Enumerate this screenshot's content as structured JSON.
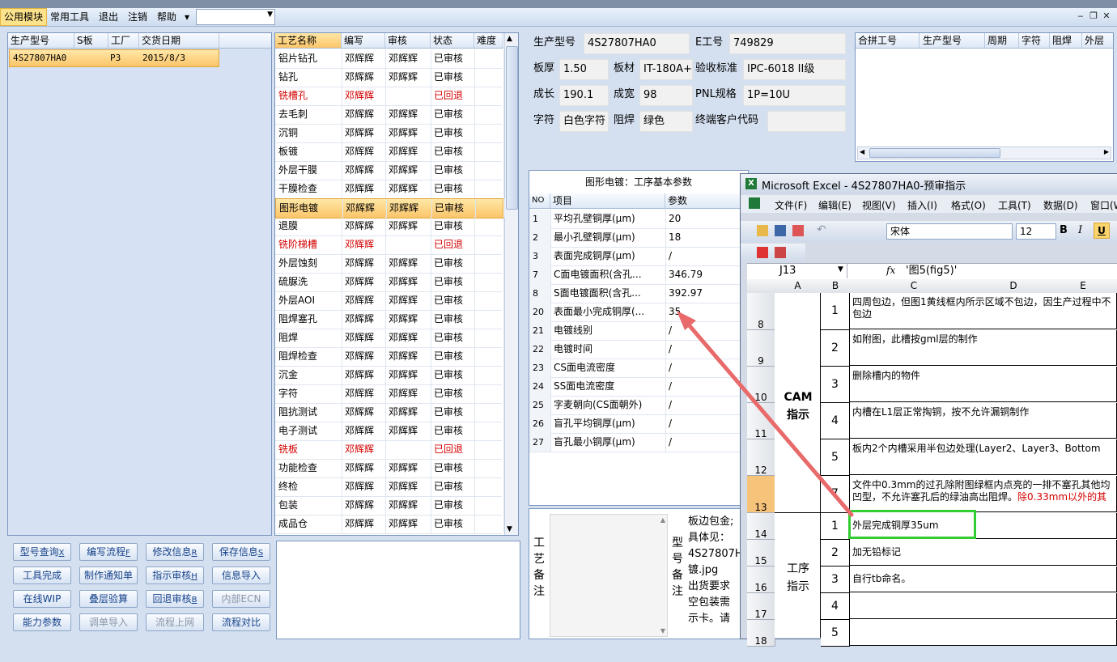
{
  "menu": {
    "items": [
      "公用模块",
      "常用工具",
      "退出",
      "注销",
      "帮助"
    ],
    "arrow": "▾"
  },
  "left_grid": {
    "headers": [
      "生产型号",
      "S板",
      "工厂",
      "交货日期"
    ],
    "rows": [
      {
        "model": "4S27807HA0",
        "s": "",
        "factory": "P3",
        "date": "2015/8/3"
      }
    ]
  },
  "process_grid": {
    "headers": [
      "工艺名称",
      "编写",
      "审核",
      "状态",
      "难度"
    ],
    "rows": [
      {
        "name": "铝片钻孔",
        "author": "邓辉辉",
        "reviewer": "邓辉辉",
        "status": "已审核",
        "red": false
      },
      {
        "name": "钻孔",
        "author": "邓辉辉",
        "reviewer": "邓辉辉",
        "status": "已审核",
        "red": false
      },
      {
        "name": "铣槽孔",
        "author": "邓辉辉",
        "reviewer": "",
        "status": "已回退",
        "red": true
      },
      {
        "name": "去毛刺",
        "author": "邓辉辉",
        "reviewer": "邓辉辉",
        "status": "已审核",
        "red": false
      },
      {
        "name": "沉铜",
        "author": "邓辉辉",
        "reviewer": "邓辉辉",
        "status": "已审核",
        "red": false
      },
      {
        "name": "板镀",
        "author": "邓辉辉",
        "reviewer": "邓辉辉",
        "status": "已审核",
        "red": false
      },
      {
        "name": "外层干膜",
        "author": "邓辉辉",
        "reviewer": "邓辉辉",
        "status": "已审核",
        "red": false
      },
      {
        "name": "干膜检查",
        "author": "邓辉辉",
        "reviewer": "邓辉辉",
        "status": "已审核",
        "red": false
      },
      {
        "name": "图形电镀",
        "author": "邓辉辉",
        "reviewer": "邓辉辉",
        "status": "已审核",
        "red": false,
        "selected": true
      },
      {
        "name": "退膜",
        "author": "邓辉辉",
        "reviewer": "邓辉辉",
        "status": "已审核",
        "red": false
      },
      {
        "name": "铣阶梯槽",
        "author": "邓辉辉",
        "reviewer": "",
        "status": "已回退",
        "red": true
      },
      {
        "name": "外层蚀刻",
        "author": "邓辉辉",
        "reviewer": "邓辉辉",
        "status": "已审核",
        "red": false
      },
      {
        "name": "硫脲洗",
        "author": "邓辉辉",
        "reviewer": "邓辉辉",
        "status": "已审核",
        "red": false
      },
      {
        "name": "外层AOI",
        "author": "邓辉辉",
        "reviewer": "邓辉辉",
        "status": "已审核",
        "red": false
      },
      {
        "name": "阻焊塞孔",
        "author": "邓辉辉",
        "reviewer": "邓辉辉",
        "status": "已审核",
        "red": false
      },
      {
        "name": "阻焊",
        "author": "邓辉辉",
        "reviewer": "邓辉辉",
        "status": "已审核",
        "red": false
      },
      {
        "name": "阻焊检查",
        "author": "邓辉辉",
        "reviewer": "邓辉辉",
        "status": "已审核",
        "red": false
      },
      {
        "name": "沉金",
        "author": "邓辉辉",
        "reviewer": "邓辉辉",
        "status": "已审核",
        "red": false
      },
      {
        "name": "字符",
        "author": "邓辉辉",
        "reviewer": "邓辉辉",
        "status": "已审核",
        "red": false
      },
      {
        "name": "阻抗测试",
        "author": "邓辉辉",
        "reviewer": "邓辉辉",
        "status": "已审核",
        "red": false
      },
      {
        "name": "电子测试",
        "author": "邓辉辉",
        "reviewer": "邓辉辉",
        "status": "已审核",
        "red": false
      },
      {
        "name": "铣板",
        "author": "邓辉辉",
        "reviewer": "",
        "status": "已回退",
        "red": true
      },
      {
        "name": "功能检查",
        "author": "邓辉辉",
        "reviewer": "邓辉辉",
        "status": "已审核",
        "red": false
      },
      {
        "name": "终检",
        "author": "邓辉辉",
        "reviewer": "邓辉辉",
        "status": "已审核",
        "red": false
      },
      {
        "name": "包装",
        "author": "邓辉辉",
        "reviewer": "邓辉辉",
        "status": "已审核",
        "red": false
      },
      {
        "name": "成品仓",
        "author": "邓辉辉",
        "reviewer": "邓辉辉",
        "status": "已审核",
        "red": false
      }
    ]
  },
  "buttons": [
    {
      "label": "型号查询",
      "key": "X",
      "disabled": false
    },
    {
      "label": "编写流程",
      "key": "F",
      "disabled": false
    },
    {
      "label": "修改信息",
      "key": "R",
      "disabled": false
    },
    {
      "label": "保存信息",
      "key": "S",
      "disabled": false
    },
    {
      "label": "工具完成",
      "key": "",
      "disabled": false
    },
    {
      "label": "制作通知单",
      "key": "",
      "disabled": false
    },
    {
      "label": "指示审核",
      "key": "H",
      "disabled": false
    },
    {
      "label": "信息导入",
      "key": "",
      "disabled": false
    },
    {
      "label": "在线WIP",
      "key": "",
      "disabled": false
    },
    {
      "label": "叠层验算",
      "key": "",
      "disabled": false
    },
    {
      "label": "回退审核",
      "key": "B",
      "disabled": false
    },
    {
      "label": "内部ECN",
      "key": "",
      "disabled": true
    },
    {
      "label": "能力参数",
      "key": "",
      "disabled": false
    },
    {
      "label": "调单导入",
      "key": "",
      "disabled": true
    },
    {
      "label": "流程上网",
      "key": "",
      "disabled": true
    },
    {
      "label": "流程对比",
      "key": "",
      "disabled": false
    }
  ],
  "info": {
    "model_label": "生产型号",
    "model_value": "4S27807HA0",
    "e_label": "E工号",
    "e_value": "749829",
    "thickness_label": "板厚",
    "thickness_value": "1.50",
    "material_label": "板材",
    "material_value": "IT-180A+",
    "standard_label": "验收标准",
    "standard_value": "IPC-6018 II级",
    "length_label": "成长",
    "length_value": "190.1",
    "width_label": "成宽",
    "width_value": "98",
    "pnl_label": "PNL规格",
    "pnl_value": "1P=10U",
    "char_label": "字符",
    "char_value": "白色字符",
    "mask_label": "阻焊",
    "mask_value": "绿色",
    "customer_label": "终端客户代码",
    "customer_value": ""
  },
  "merge_grid": {
    "headers": [
      "合拼工号",
      "生产型号",
      "周期",
      "字符",
      "阻焊",
      "外层"
    ]
  },
  "param_panel": {
    "title": "图形电镀：工序基本参数",
    "headers": [
      "NO",
      "项目",
      "参数"
    ],
    "rows": [
      {
        "no": "1",
        "item": "平均孔壁铜厚(μm)",
        "value": "20"
      },
      {
        "no": "2",
        "item": "最小孔壁铜厚(μm)",
        "value": "18"
      },
      {
        "no": "3",
        "item": "表面完成铜厚(μm)",
        "value": "/"
      },
      {
        "no": "7",
        "item": "C面电镀面积(含孔...",
        "value": "346.79"
      },
      {
        "no": "8",
        "item": "S面电镀面积(含孔...",
        "value": "392.97"
      },
      {
        "no": "20",
        "item": "表面最小完成铜厚(...",
        "value": "35"
      },
      {
        "no": "21",
        "item": "电镀线别",
        "value": "/"
      },
      {
        "no": "22",
        "item": "电镀时间",
        "value": "/"
      },
      {
        "no": "23",
        "item": "CS面电流密度",
        "value": "/"
      },
      {
        "no": "24",
        "item": "SS面电流密度",
        "value": "/"
      },
      {
        "no": "25",
        "item": "字麦朝向(CS面朝外)",
        "value": "/"
      },
      {
        "no": "26",
        "item": "盲孔平均铜厚(μm)",
        "value": "/"
      },
      {
        "no": "27",
        "item": "盲孔最小铜厚(μm)",
        "value": "/"
      }
    ]
  },
  "remarks": {
    "process_label": "工艺备注",
    "model_label": "型号备注",
    "model_text": [
      "板边包金;",
      "具体见：",
      "4S27807H",
      "镀.jpg",
      "出货要求",
      "空包装需",
      "示卡。请"
    ]
  },
  "excel": {
    "title": "Microsoft Excel - 4S27807HA0-预审指示",
    "menu": [
      "文件(F)",
      "编辑(E)",
      "视图(V)",
      "插入(I)",
      "格式(O)",
      "工具(T)",
      "数据(D)",
      "窗口(W)"
    ],
    "font_name": "宋体",
    "font_size": "12",
    "cell_ref": "J13",
    "fx": "fx",
    "formula": "'图5(fig5)'",
    "col_headers": [
      "A",
      "B",
      "C",
      "D",
      "E"
    ],
    "group_cam": "CAM指示",
    "group_proc": "工序指示",
    "rows": [
      {
        "num": "8",
        "b": "1",
        "c": "四周包边，但图1黄线框内所示区域不包边，因生产过程中不包边",
        "red": ""
      },
      {
        "num": "9",
        "b": "2",
        "c": "如附图，此槽按gml层的制作",
        "red": ""
      },
      {
        "num": "10",
        "b": "3",
        "c": "删除槽内的物件",
        "red": ""
      },
      {
        "num": "11",
        "b": "4",
        "c": "内槽在L1层正常掏铜，按不允许漏铜制作",
        "red": ""
      },
      {
        "num": "12",
        "b": "5",
        "c": "板内2个内槽采用半包边处理(Layer2、Layer3、Bottom",
        "red": ""
      },
      {
        "num": "13",
        "b": "7",
        "c": "文件中0.3mm的过孔除附图绿框内点亮的一排不塞孔其他均凹型，不允许塞孔后的绿油高出阻焊。",
        "red": "除0.33mm以外的其"
      },
      {
        "num": "14",
        "b": "1",
        "c": "外层完成铜厚35um",
        "red": ""
      },
      {
        "num": "15",
        "b": "2",
        "c": "加无铅标记",
        "red": ""
      },
      {
        "num": "16",
        "b": "3",
        "c": "自行tb命名。",
        "red": ""
      },
      {
        "num": "17",
        "b": "4",
        "c": "",
        "red": ""
      },
      {
        "num": "18",
        "b": "5",
        "c": "",
        "red": ""
      }
    ]
  },
  "colors": {
    "accent": "#fbc56a",
    "highlight_box": "#33cc33",
    "arrow": "#e86a6a",
    "red_text": "#d40000"
  }
}
